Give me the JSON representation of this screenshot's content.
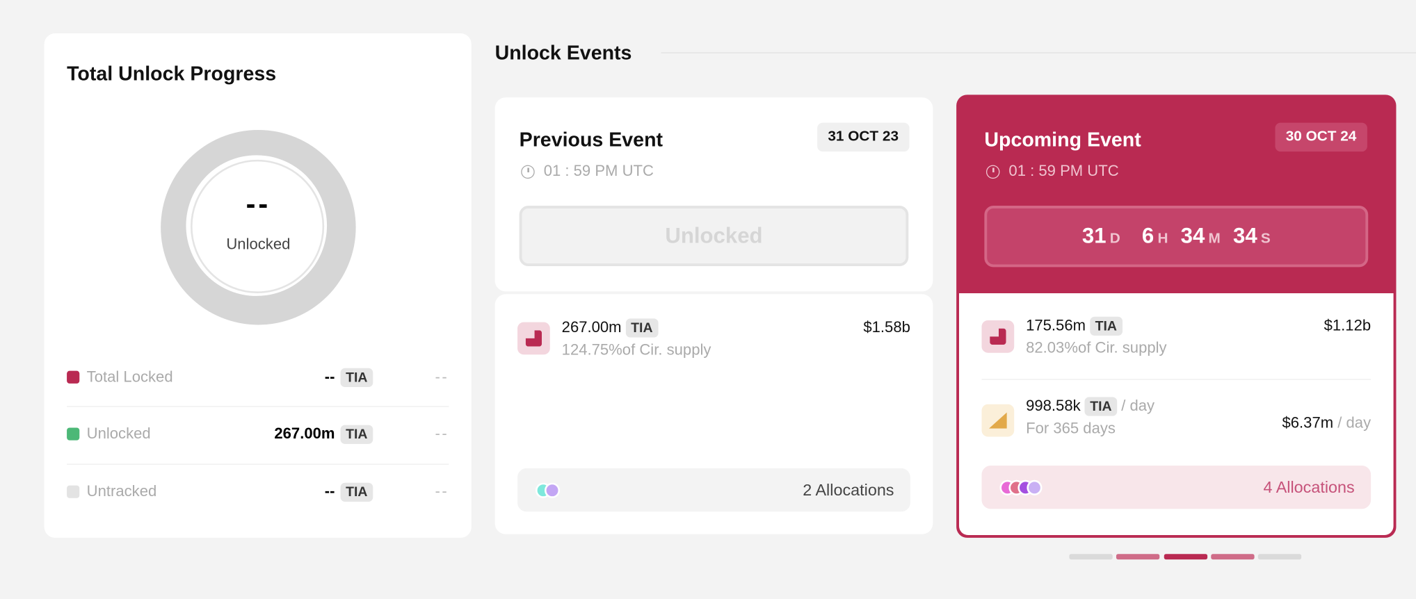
{
  "progress": {
    "title": "Total Unlock Progress",
    "center_value": "--",
    "center_label": "Unlocked",
    "legend": [
      {
        "label": "Total Locked",
        "value": "--",
        "token": "TIA",
        "usd": "--",
        "color": "#b92a52"
      },
      {
        "label": "Unlocked",
        "value": "267.00m",
        "token": "TIA",
        "usd": "--",
        "color": "#4cb877"
      },
      {
        "label": "Untracked",
        "value": "--",
        "token": "TIA",
        "usd": "--",
        "color": "#e3e3e3"
      }
    ]
  },
  "events": {
    "title": "Unlock Events",
    "previous": {
      "title": "Previous Event",
      "date": "31 OCT 23",
      "time": "01 : 59 PM UTC",
      "status": "Unlocked",
      "items": [
        {
          "amount": "267.00m",
          "token": "TIA",
          "supply": "124.75%of Cir. supply",
          "usd": "$1.58b",
          "icon": "cliff-unlock-icon"
        }
      ],
      "allocations": "2 Allocations",
      "allocation_colors": [
        "#7ee8dc",
        "#c3a6f4"
      ]
    },
    "upcoming": {
      "title": "Upcoming Event",
      "date": "30 OCT 24",
      "time": "01 : 59 PM UTC",
      "countdown": {
        "days": "31",
        "d": "D",
        "hours": "6",
        "h": "H",
        "minutes": "34",
        "m": "M",
        "seconds": "34",
        "s": "S"
      },
      "items": [
        {
          "amount": "175.56m",
          "token": "TIA",
          "supply": "82.03%of Cir. supply",
          "usd": "$1.12b",
          "icon": "cliff-unlock-icon"
        },
        {
          "amount": "998.58k",
          "token": "TIA",
          "per": "/ day",
          "duration": "For 365 days",
          "usd": "$6.37m",
          "usd_per": "/ day",
          "icon": "linear-unlock-icon"
        }
      ],
      "allocations": "4 Allocations",
      "allocation_colors": [
        "#e86ad6",
        "#e0708a",
        "#a44fe0",
        "#c9b0f4"
      ]
    },
    "accent": "#b92a52",
    "pagination": {
      "pages": 5,
      "active": 3
    }
  }
}
